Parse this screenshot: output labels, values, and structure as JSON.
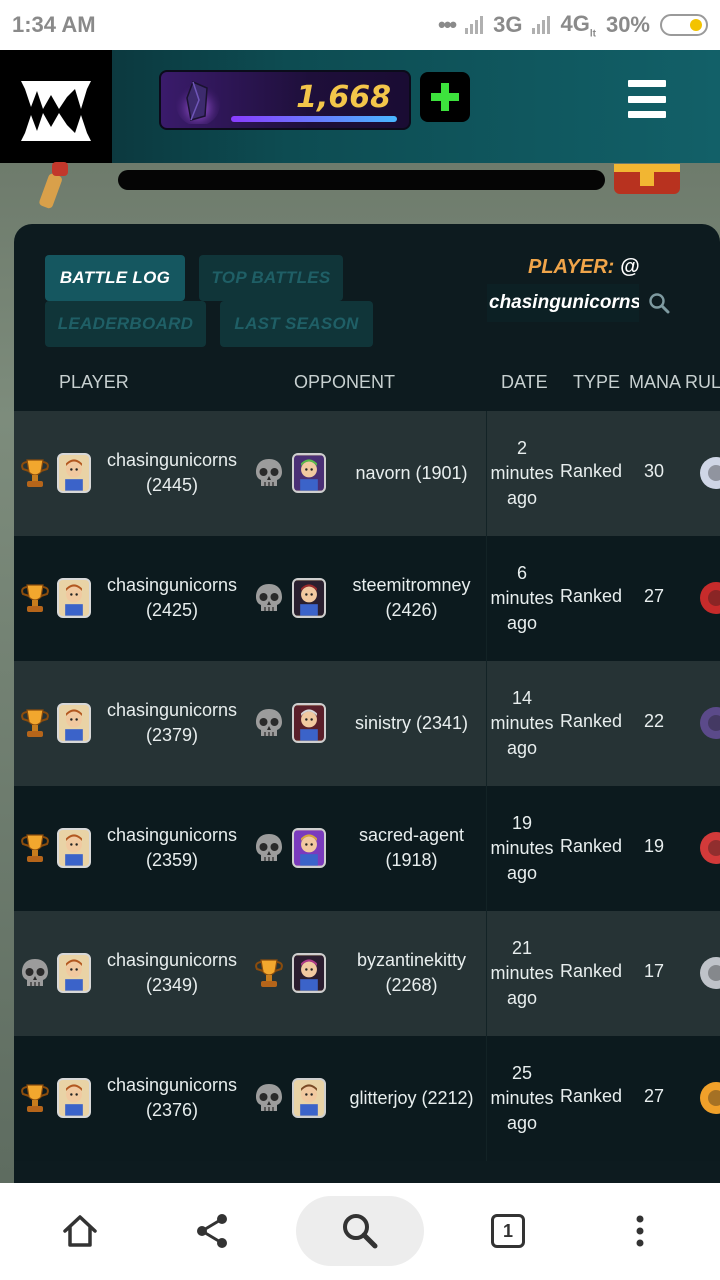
{
  "status_bar": {
    "time": "1:34 AM",
    "dots": "•••",
    "net1": "3G",
    "net2": "4G",
    "net2_sub": "lt",
    "battery": "30%"
  },
  "header": {
    "dec_amount": "1,668",
    "plus_icon": "plus-icon",
    "menu_icon": "hamburger-menu-icon"
  },
  "tabs": [
    {
      "label": "BATTLE LOG",
      "active": true
    },
    {
      "label": "TOP BATTLES",
      "active": false
    },
    {
      "label": "LEADERBOARD",
      "active": false
    },
    {
      "label": "LAST SEASON",
      "active": false
    }
  ],
  "player": {
    "label": "PLAYER:",
    "at": "@",
    "value": "chasingunicorns"
  },
  "columns": {
    "player": "PLAYER",
    "opponent": "OPPONENT",
    "date": "DATE",
    "type": "TYPE",
    "mana": "MANA",
    "rules": "RUL"
  },
  "rows": [
    {
      "player_result": "trophy",
      "player_name": "chasingunicorns",
      "player_rating": "(2445)",
      "opp_result": "skull",
      "opp_name": "navorn (1901)",
      "opp_rating": "",
      "date_num": "2",
      "date_unit": "minutes",
      "date_ago": "ago",
      "type": "Ranked",
      "mana": "30"
    },
    {
      "player_result": "trophy",
      "player_name": "chasingunicorns",
      "player_rating": "(2425)",
      "opp_result": "skull",
      "opp_name": "steemitromney",
      "opp_rating": "(2426)",
      "date_num": "6",
      "date_unit": "minutes",
      "date_ago": "ago",
      "type": "Ranked",
      "mana": "27"
    },
    {
      "player_result": "trophy",
      "player_name": "chasingunicorns",
      "player_rating": "(2379)",
      "opp_result": "skull",
      "opp_name": "sinistry (2341)",
      "opp_rating": "",
      "date_num": "14",
      "date_unit": "minutes",
      "date_ago": "ago",
      "type": "Ranked",
      "mana": "22"
    },
    {
      "player_result": "trophy",
      "player_name": "chasingunicorns",
      "player_rating": "(2359)",
      "opp_result": "skull",
      "opp_name": "sacred-agent",
      "opp_rating": "(1918)",
      "date_num": "19",
      "date_unit": "minutes",
      "date_ago": "ago",
      "type": "Ranked",
      "mana": "19"
    },
    {
      "player_result": "skull",
      "player_name": "chasingunicorns",
      "player_rating": "(2349)",
      "opp_result": "trophy",
      "opp_name": "byzantinekitty",
      "opp_rating": "(2268)",
      "date_num": "21",
      "date_unit": "minutes",
      "date_ago": "ago",
      "type": "Ranked",
      "mana": "17"
    },
    {
      "player_result": "trophy",
      "player_name": "chasingunicorns",
      "player_rating": "(2376)",
      "opp_result": "skull",
      "opp_name": "glitterjoy (2212)",
      "opp_rating": "",
      "date_num": "25",
      "date_unit": "minutes",
      "date_ago": "ago",
      "type": "Ranked",
      "mana": "27"
    }
  ],
  "bottom_nav": {
    "tab_count": "1"
  },
  "colors": {
    "accent_teal": "#155760",
    "player_label": "#f0a54a",
    "dec_gold": "#f3c64a"
  }
}
